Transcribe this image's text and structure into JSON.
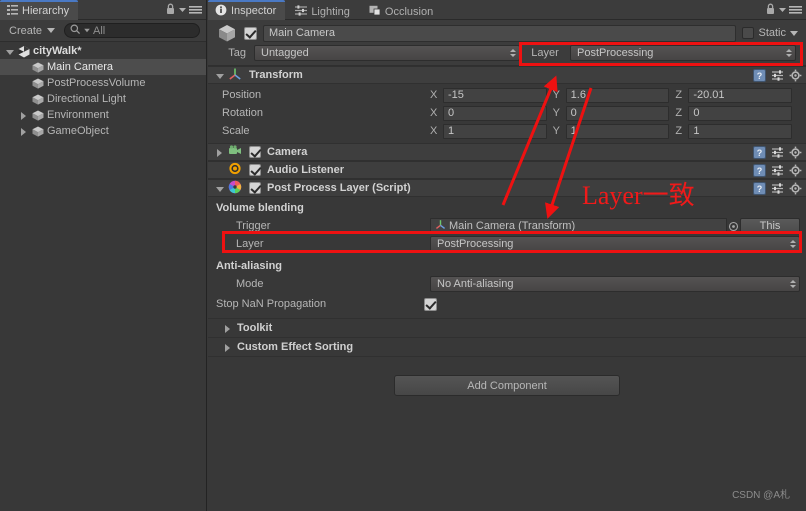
{
  "hierarchy": {
    "tab_label": "Hierarchy",
    "tab_icon": "hierarchy-icon",
    "create_label": "Create",
    "search_placeholder": "All",
    "search_value": "All",
    "lock_icon": "lock-icon",
    "menu_icon": "hamburger-menu-icon",
    "scene": {
      "label": "cityWalk*",
      "expanded": true
    },
    "items": [
      {
        "label": "Main Camera",
        "selected": true,
        "expandable": false
      },
      {
        "label": "PostProcessVolume",
        "selected": false,
        "expandable": false
      },
      {
        "label": "Directional Light",
        "selected": false,
        "expandable": false
      },
      {
        "label": "Environment",
        "selected": false,
        "expandable": true
      },
      {
        "label": "GameObject",
        "selected": false,
        "expandable": true
      }
    ]
  },
  "inspector": {
    "tabs": [
      {
        "label": "Inspector",
        "icon": "info-icon",
        "active": true
      },
      {
        "label": "Lighting",
        "icon": "lighting-icon",
        "active": false
      },
      {
        "label": "Occlusion",
        "icon": "occlusion-icon",
        "active": false
      }
    ],
    "lock_icon": "lock-icon",
    "menu_icon": "hamburger-menu-icon",
    "object": {
      "icon": "gameobject-cube-icon",
      "enabled": true,
      "name": "Main Camera",
      "static_label": "Static",
      "static_checked": false,
      "tag_label": "Tag",
      "tag_value": "Untagged",
      "layer_label": "Layer",
      "layer_value": "PostProcessing"
    },
    "transform": {
      "title": "Transform",
      "icon": "transform-axis-icon",
      "expanded": true,
      "rows": [
        {
          "label": "Position",
          "x": "-15",
          "y": "1.6",
          "z": "-20.01"
        },
        {
          "label": "Rotation",
          "x": "0",
          "y": "0",
          "z": "0"
        },
        {
          "label": "Scale",
          "x": "1",
          "y": "1",
          "z": "1"
        }
      ],
      "axis_x": "X",
      "axis_y": "Y",
      "axis_z": "Z"
    },
    "camera": {
      "title": "Camera",
      "icon": "camera-icon",
      "enabled": true,
      "expanded": false
    },
    "audio_listener": {
      "title": "Audio Listener",
      "icon": "audio-listener-icon",
      "enabled": true
    },
    "post_process_layer": {
      "title": "Post Process Layer (Script)",
      "icon": "post-process-aperture-icon",
      "enabled": true,
      "expanded": true,
      "volume_blending_label": "Volume blending",
      "trigger_label": "Trigger",
      "trigger_value": "Main Camera (Transform)",
      "trigger_value_icon": "transform-axis-icon",
      "this_button": "This",
      "layer_label": "Layer",
      "layer_value": "PostProcessing",
      "antialiasing_label": "Anti-aliasing",
      "mode_label": "Mode",
      "mode_value": "No Anti-aliasing",
      "stop_nan_label": "Stop NaN Propagation",
      "stop_nan_checked": true,
      "toolkit_label": "Toolkit",
      "custom_effect_sorting_label": "Custom Effect Sorting"
    },
    "add_component_label": "Add Component"
  },
  "annotations": {
    "note_text": "Layer一致",
    "color": "#ee1111"
  },
  "watermark": "CSDN @A札"
}
